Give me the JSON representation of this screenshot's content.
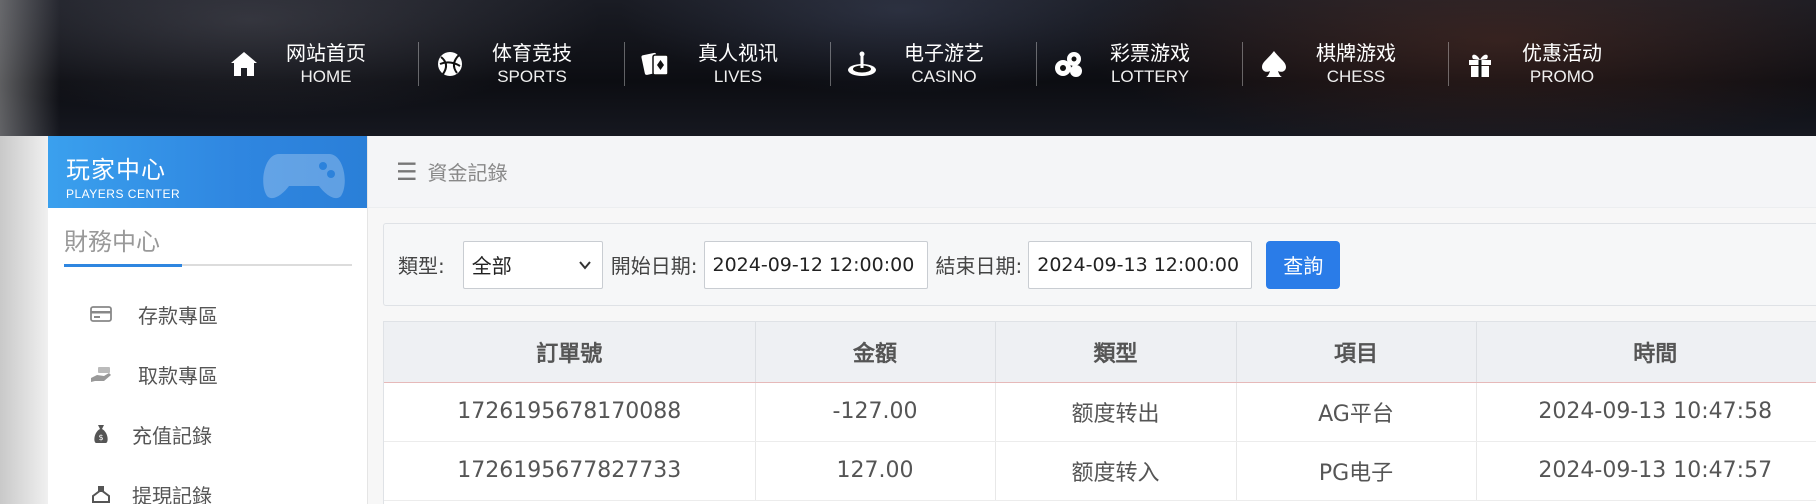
{
  "nav": {
    "items": [
      {
        "cn": "网站首页",
        "en": "HOME",
        "icon": "home-icon"
      },
      {
        "cn": "体育竞技",
        "en": "SPORTS",
        "icon": "ball-icon"
      },
      {
        "cn": "真人视讯",
        "en": "LIVES",
        "icon": "cards-icon"
      },
      {
        "cn": "电子游艺",
        "en": "CASINO",
        "icon": "roulette-icon"
      },
      {
        "cn": "彩票游戏",
        "en": "LOTTERY",
        "icon": "lottery-balls-icon"
      },
      {
        "cn": "棋牌游戏",
        "en": "CHESS",
        "icon": "spade-icon"
      },
      {
        "cn": "优惠活动",
        "en": "PROMO",
        "icon": "gift-icon"
      }
    ]
  },
  "sidebar": {
    "header_title": "玩家中心",
    "header_subtitle": "PLAYERS CENTER",
    "section_title": "財務中心",
    "items": [
      {
        "label": "存款專區",
        "icon": "card-icon"
      },
      {
        "label": "取款專區",
        "icon": "hand-cash-icon"
      },
      {
        "label": "充值記錄",
        "icon": "money-bag-icon"
      },
      {
        "label": "提現記錄",
        "icon": "withdraw-icon"
      }
    ]
  },
  "main": {
    "breadcrumb": "資金記錄",
    "filter": {
      "type_label": "類型:",
      "type_value": "全部",
      "start_label": "開始日期:",
      "start_value": "2024-09-12 12:00:00",
      "end_label": "結束日期:",
      "end_value": "2024-09-13 12:00:00",
      "query_label": "查詢"
    },
    "table": {
      "headers": [
        "訂單號",
        "金額",
        "類型",
        "項目",
        "時間"
      ],
      "rows": [
        [
          "1726195678170088",
          "-127.00",
          "额度转出",
          "AG平台",
          "2024-09-13 10:47:58"
        ],
        [
          "1726195677827733",
          "127.00",
          "额度转入",
          "PG电子",
          "2024-09-13 10:47:57"
        ]
      ]
    }
  },
  "colors": {
    "accent": "#2a7ce8",
    "sidebar_header": "#2f86e0",
    "topbar": "#0c0d12"
  }
}
